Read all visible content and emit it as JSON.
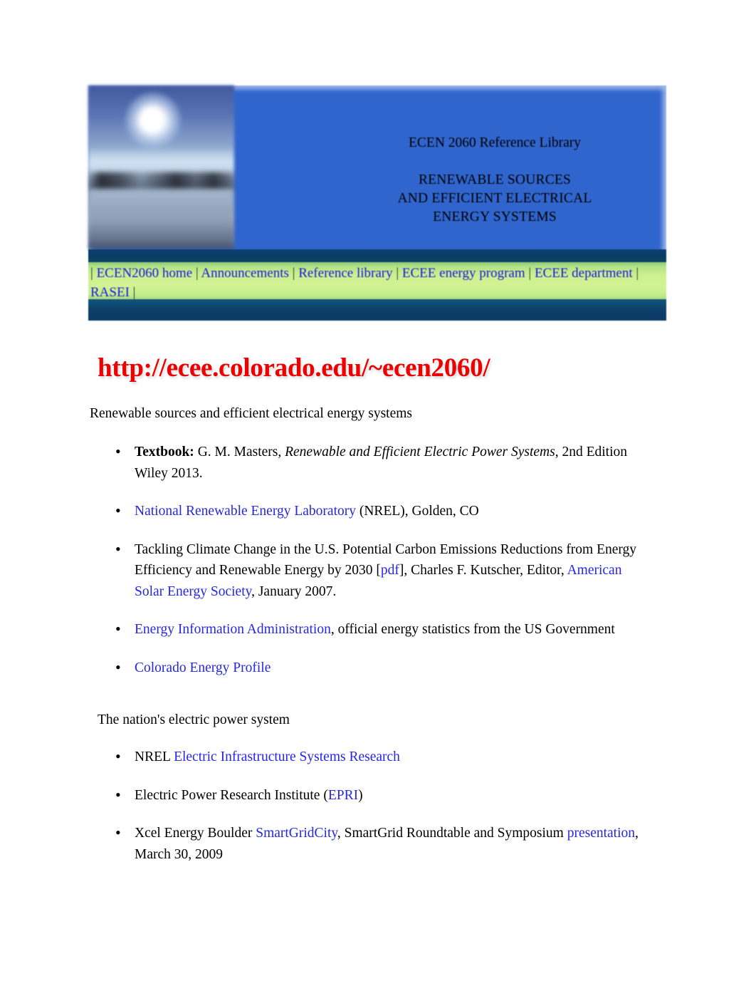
{
  "banner": {
    "photo_alt": "sun-over-water-photo",
    "title_main": "ECEN 2060 Reference Library",
    "title_caps_1": "RENEWABLE SOURCES",
    "title_caps_2": "AND EFFICIENT ELECTRICAL",
    "title_caps_3": "ENERGY SYSTEMS",
    "colors": {
      "banner_blue": "#3065CE",
      "nav_green": "#CCF090",
      "dark_band": "#0D3F6B",
      "link_blue": "#2626E6",
      "url_red": "#EE0000"
    }
  },
  "nav": {
    "separator": "|",
    "items": [
      {
        "label": "ECEN2060 home"
      },
      {
        "label": "Announcements"
      },
      {
        "label": "Reference library"
      },
      {
        "label": "ECEE energy program"
      },
      {
        "label": "ECEE department"
      },
      {
        "label": "RASEI"
      }
    ]
  },
  "page": {
    "url_heading": "http://ecee.colorado.edu/~ecen2060/",
    "intro": "Renewable sources and efficient electrical energy systems",
    "section_heading": "The nation's electric power system"
  },
  "list_1": [
    {
      "parts": [
        {
          "text": "Textbook:",
          "style": "bold"
        },
        {
          "text": " G. M. Masters, ",
          "style": "plain"
        },
        {
          "text": "Renewable and Efficient Electric Power Systems",
          "style": "italic"
        },
        {
          "text": ", 2nd Edition Wiley 2013.",
          "style": "plain"
        }
      ]
    },
    {
      "parts": [
        {
          "text": "National Renewable Energy Laboratory",
          "style": "link"
        },
        {
          "text": " (NREL), Golden, CO",
          "style": "plain"
        }
      ]
    },
    {
      "parts": [
        {
          "text": "Tackling Climate Change in the U.S. Potential Carbon Emissions Reductions from Energy Efficiency and Renewable Energy by 2030 [",
          "style": "plain"
        },
        {
          "text": "pdf",
          "style": "link"
        },
        {
          "text": "], Charles F. Kutscher, Editor, ",
          "style": "plain"
        },
        {
          "text": "American Solar Energy Society",
          "style": "link"
        },
        {
          "text": ", January 2007.",
          "style": "plain"
        }
      ]
    },
    {
      "parts": [
        {
          "text": "Energy Information Administration",
          "style": "link"
        },
        {
          "text": ", official energy statistics from the US Government",
          "style": "plain"
        }
      ]
    },
    {
      "parts": [
        {
          "text": "Colorado Energy Profile",
          "style": "link"
        }
      ]
    }
  ],
  "list_2": [
    {
      "parts": [
        {
          "text": "NREL ",
          "style": "plain"
        },
        {
          "text": "Electric Infrastructure Systems Research",
          "style": "link"
        }
      ]
    },
    {
      "parts": [
        {
          "text": "Electric Power Research Institute (",
          "style": "plain"
        },
        {
          "text": "EPRI",
          "style": "link"
        },
        {
          "text": ")",
          "style": "plain"
        }
      ]
    },
    {
      "parts": [
        {
          "text": "Xcel Energy Boulder ",
          "style": "plain"
        },
        {
          "text": "SmartGridCity",
          "style": "link"
        },
        {
          "text": ", SmartGrid Roundtable and Symposium ",
          "style": "plain"
        },
        {
          "text": "presentation",
          "style": "link"
        },
        {
          "text": ", March 30, 2009",
          "style": "plain"
        }
      ]
    }
  ]
}
